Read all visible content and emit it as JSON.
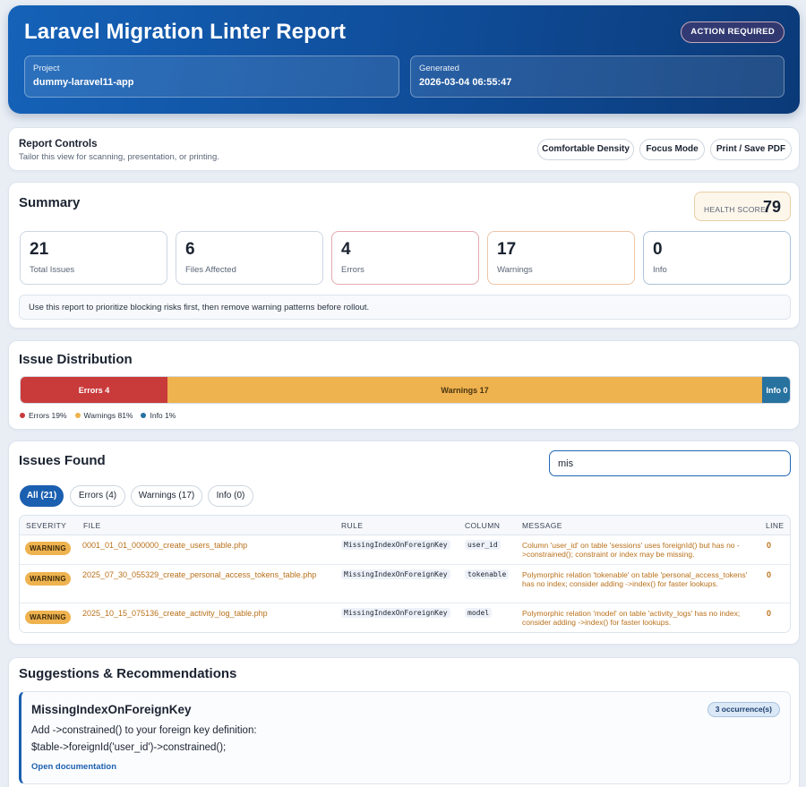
{
  "header": {
    "title": "Laravel Migration Linter Report",
    "status_badge": "ACTION REQUIRED",
    "project_label": "Project",
    "project_value": "dummy-laravel11-app",
    "generated_label": "Generated",
    "generated_value": "2026-03-04 06:55:47"
  },
  "controls": {
    "title": "Report Controls",
    "subtitle": "Tailor this view for scanning, presentation, or printing.",
    "density_button": "Comfortable Density",
    "focus_button": "Focus Mode",
    "print_button": "Print / Save PDF"
  },
  "summary": {
    "title": "Summary",
    "health_label": "HEALTH SCORE",
    "health_value": "79",
    "stats": [
      {
        "value": "21",
        "label": "Total Issues"
      },
      {
        "value": "6",
        "label": "Files Affected"
      },
      {
        "value": "4",
        "label": "Errors"
      },
      {
        "value": "17",
        "label": "Warnings"
      },
      {
        "value": "0",
        "label": "Info"
      }
    ],
    "note": "Use this report to prioritize blocking risks first, then remove warning patterns before rollout."
  },
  "distribution": {
    "title": "Issue Distribution",
    "segments": [
      {
        "label": "Errors 4",
        "count": 4,
        "color": "#c93a3a"
      },
      {
        "label": "Warnings 17",
        "count": 17,
        "color": "#eeb24f"
      },
      {
        "label": "Info 0",
        "count": 0,
        "color": "#27729f"
      }
    ],
    "legend": [
      {
        "label": "Errors 19%",
        "color": "#c93a3a"
      },
      {
        "label": "Warnings 81%",
        "color": "#eeb24f"
      },
      {
        "label": "Info 1%",
        "color": "#27729f"
      }
    ]
  },
  "issues": {
    "title": "Issues Found",
    "search_value": "mis",
    "filters": [
      "All (21)",
      "Errors (4)",
      "Warnings (17)",
      "Info (0)"
    ],
    "columns": [
      "SEVERITY",
      "FILE",
      "RULE",
      "COLUMN",
      "MESSAGE",
      "LINE"
    ],
    "rows": [
      {
        "severity": "WARNING",
        "file": "0001_01_01_000000_create_users_table.php",
        "rule": "MissingIndexOnForeignKey",
        "column": "user_id",
        "message": "Column 'user_id' on table 'sessions' uses foreignId() but has no ->constrained(); constraint or index may be missing.",
        "line": "0"
      },
      {
        "severity": "WARNING",
        "file": "2025_07_30_055329_create_personal_access_tokens_table.php",
        "rule": "MissingIndexOnForeignKey",
        "column": "tokenable",
        "message": "Polymorphic relation 'tokenable' on table 'personal_access_tokens' has no index; consider adding ->index() for faster lookups.",
        "line": "0"
      },
      {
        "severity": "WARNING",
        "file": "2025_10_15_075136_create_activity_log_table.php",
        "rule": "MissingIndexOnForeignKey",
        "column": "model",
        "message": "Polymorphic relation 'model' on table 'activity_logs' has no index; consider adding ->index() for faster lookups.",
        "line": "0"
      }
    ]
  },
  "suggestions": {
    "title": "Suggestions & Recommendations",
    "rule": "MissingIndexOnForeignKey",
    "occurrences": "3 occurrence(s)",
    "line1": "Add ->constrained() to your foreign key definition:",
    "line2": "$table->foreignId('user_id')->constrained();",
    "link": "Open documentation"
  }
}
